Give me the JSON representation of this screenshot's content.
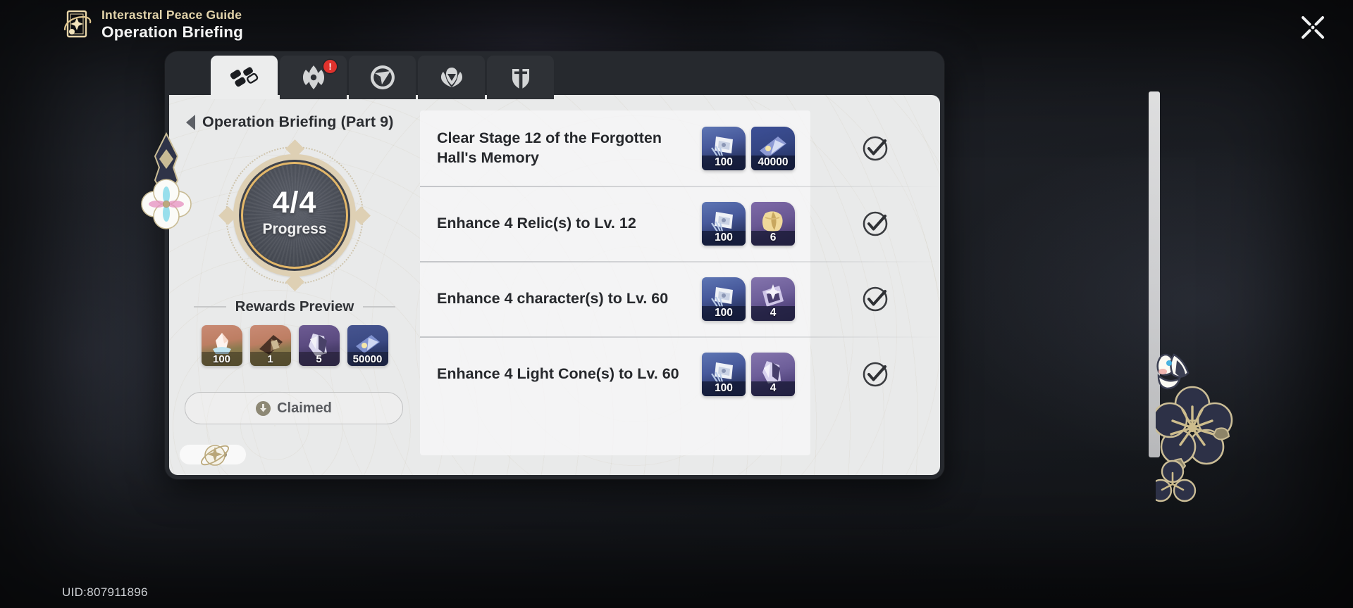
{
  "header": {
    "subtitle": "Interastral Peace Guide",
    "title": "Operation Briefing",
    "emblem_icon": "guide-book-emblem",
    "close_icon": "close-icon"
  },
  "uid": "UID:807911896",
  "tabs": [
    {
      "icon": "domino-blocks-icon",
      "label": "Operation Briefing",
      "active": true,
      "badge": ""
    },
    {
      "icon": "caltrop-cross-icon",
      "label": "Calyx",
      "active": false,
      "badge": "!"
    },
    {
      "icon": "cavern-arrow-icon",
      "label": "Cavern of Corrosion",
      "active": false,
      "badge": ""
    },
    {
      "icon": "shell-fan-icon",
      "label": "Echo of War",
      "active": false,
      "badge": ""
    },
    {
      "icon": "shield-sword-icon",
      "label": "Simulated Universe",
      "active": false,
      "badge": ""
    }
  ],
  "breadcrumb": {
    "back_icon": "back-caret-icon",
    "label": "Operation Briefing (Part 9)"
  },
  "progress": {
    "value": "4/4",
    "label": "Progress",
    "current": 4,
    "total": 4
  },
  "rewards_preview": {
    "title": "Rewards Preview",
    "items": [
      {
        "name": "stellar-jade",
        "qty": "100",
        "color": "#bd7e63"
      },
      {
        "name": "star-rail-pass",
        "qty": "1",
        "color": "#bd7e63"
      },
      {
        "name": "refined-aether",
        "qty": "5",
        "color": "#5b4b80"
      },
      {
        "name": "credit",
        "qty": "50000",
        "color": "#3b4a84"
      }
    ]
  },
  "claim_button": {
    "label": "Claimed",
    "icon": "claimed-clock-icon",
    "state": "claimed"
  },
  "orbit_control": {
    "emblem_icon": "planet-orbit-icon",
    "dot_icon": "slider-dot-icon"
  },
  "tasks": [
    {
      "name": "Clear Stage 12 of the Forgotten Hall's Memory",
      "status_icon": "check-circle-icon",
      "completed": true,
      "rewards": [
        {
          "name": "trailblaze-exp",
          "qty": "100",
          "style": "bg-credit"
        },
        {
          "name": "credit",
          "qty": "40000",
          "style": "bg-exp"
        }
      ]
    },
    {
      "name": "Enhance 4 Relic(s) to Lv. 12",
      "status_icon": "check-circle-icon",
      "completed": true,
      "rewards": [
        {
          "name": "trailblaze-exp",
          "qty": "100",
          "style": "bg-credit"
        },
        {
          "name": "relic-remains",
          "qty": "6",
          "style": "bg-relic"
        }
      ]
    },
    {
      "name": "Enhance 4 character(s) to Lv. 60",
      "status_icon": "check-circle-icon",
      "completed": true,
      "rewards": [
        {
          "name": "trailblaze-exp",
          "qty": "100",
          "style": "bg-credit"
        },
        {
          "name": "travel-encounters",
          "qty": "4",
          "style": "bg-lc"
        }
      ]
    },
    {
      "name": "Enhance 4 Light Cone(s) to Lv. 60",
      "status_icon": "check-circle-icon",
      "completed": true,
      "rewards": [
        {
          "name": "trailblaze-exp",
          "qty": "100",
          "style": "bg-credit"
        },
        {
          "name": "condensed-aether",
          "qty": "4",
          "style": "bg-lc"
        }
      ]
    }
  ],
  "decorations": [
    {
      "name": "white-flower-ornament-left",
      "icon": "flower-ornament-icon"
    },
    {
      "name": "gold-navy-flowers-right",
      "icon": "flower-cluster-icon"
    },
    {
      "name": "white-creature-deco",
      "icon": "bunny-icon"
    }
  ],
  "colors": {
    "accent_gold": "#e3b769",
    "panel_bg": "#e9eaea",
    "window_bg": "#26292e",
    "badge_red": "#e0322d",
    "header_subtitle": "#e3d4ab"
  }
}
